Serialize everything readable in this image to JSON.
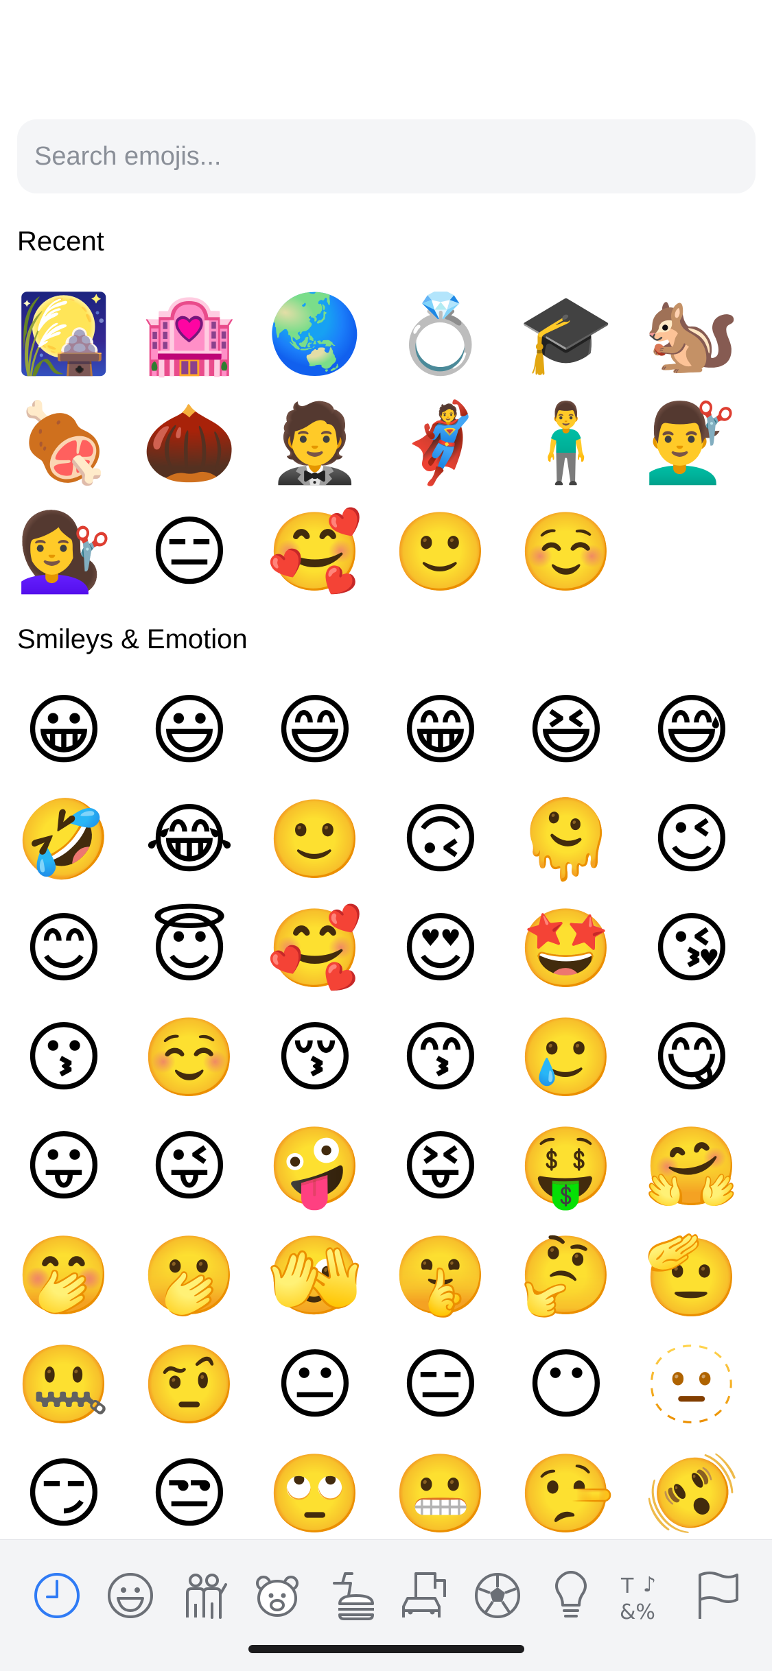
{
  "search": {
    "placeholder": "Search emojis...",
    "value": ""
  },
  "sections": {
    "recent": {
      "title": "Recent",
      "emojis": [
        "🎑",
        "🏩",
        "🌏",
        "💍",
        "🎓",
        "🐿️",
        "🍖",
        "🌰",
        "🤵",
        "🦸",
        "🧍‍♂️",
        "💇‍♂️",
        "💇‍♀️",
        "😑",
        "🥰",
        "🙂",
        "☺️"
      ]
    },
    "smileys": {
      "title": "Smileys & Emotion",
      "emojis": [
        "😀",
        "😃",
        "😄",
        "😁",
        "😆",
        "😅",
        "🤣",
        "😂",
        "🙂",
        "🙃",
        "🫠",
        "😉",
        "😊",
        "😇",
        "🥰",
        "😍",
        "🤩",
        "😘",
        "😗",
        "☺️",
        "😚",
        "😙",
        "🥲",
        "😋",
        "😛",
        "😜",
        "🤪",
        "😝",
        "🤑",
        "🤗",
        "🤭",
        "🫢",
        "🫣",
        "🤫",
        "🤔",
        "🫡",
        "🤐",
        "🤨",
        "😐",
        "😑",
        "😶",
        "🫥",
        "😏",
        "😒",
        "🙄",
        "😬",
        "🤥",
        "🫨"
      ]
    }
  },
  "tabs": [
    {
      "name": "recent",
      "active": true
    },
    {
      "name": "smileys",
      "active": false
    },
    {
      "name": "people",
      "active": false
    },
    {
      "name": "animals",
      "active": false
    },
    {
      "name": "food",
      "active": false
    },
    {
      "name": "travel",
      "active": false
    },
    {
      "name": "activity",
      "active": false
    },
    {
      "name": "objects",
      "active": false
    },
    {
      "name": "symbols",
      "active": false
    },
    {
      "name": "flags",
      "active": false
    }
  ],
  "colors": {
    "accent": "#2f7bf5",
    "icon": "#6b6f76",
    "tabbar_bg": "#f3f4f6",
    "search_bg": "#f4f5f7"
  }
}
